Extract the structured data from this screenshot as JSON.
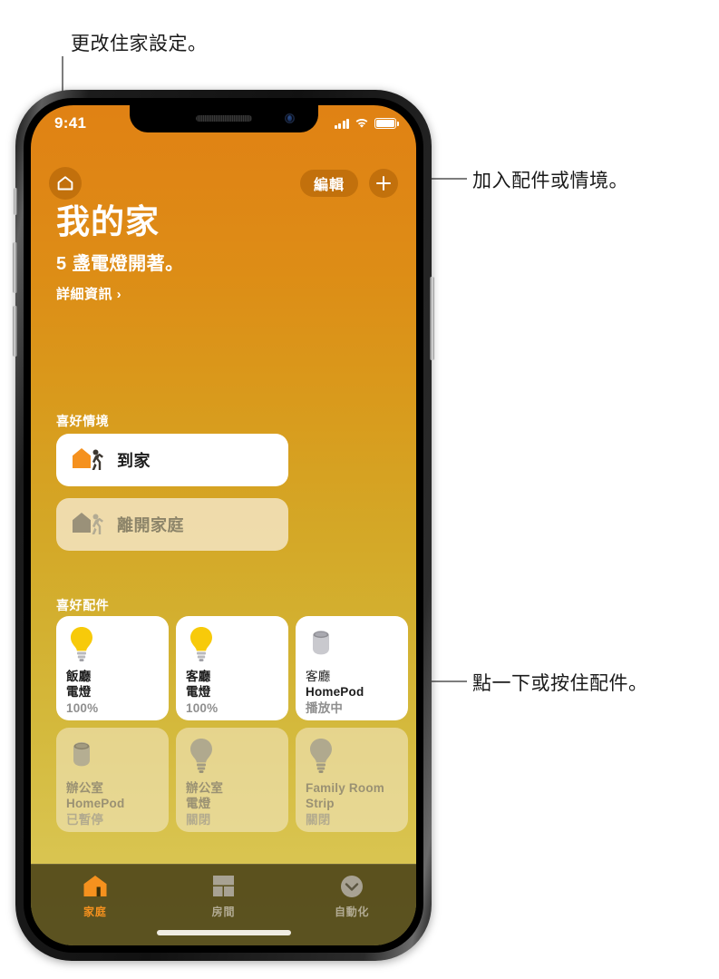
{
  "callouts": [
    {
      "id": "settings",
      "text": "更改住家設定。"
    },
    {
      "id": "add",
      "text": "加入配件或情境。"
    },
    {
      "id": "accessory",
      "text": "點一下或按住配件。"
    }
  ],
  "statusbar": {
    "time": "9:41",
    "cellular_icon": "signal-bars-icon",
    "wifi_icon": "wifi-icon",
    "battery_icon": "battery-icon"
  },
  "nav": {
    "home_icon": "house-icon",
    "edit_label": "編輯",
    "add_icon": "plus-icon"
  },
  "header": {
    "title": "我的家",
    "status": "5 盞電燈開著。",
    "details_link": "詳細資訊 ›"
  },
  "scenes": {
    "section_title": "喜好情境",
    "items": [
      {
        "label": "到家",
        "state": "on",
        "icon": "house-arriving-icon"
      },
      {
        "label": "離開家庭",
        "state": "off",
        "icon": "house-leaving-icon"
      }
    ]
  },
  "accessories": {
    "section_title": "喜好配件",
    "items": [
      {
        "name": "飯廳\n電燈",
        "name_line1": "飯廳",
        "name_line2": "電燈",
        "status": "100%",
        "state": "on",
        "icon": "lightbulb-icon",
        "name_weight": "bold"
      },
      {
        "name": "客廳\n電燈",
        "name_line1": "客廳",
        "name_line2": "電燈",
        "status": "100%",
        "state": "on",
        "icon": "lightbulb-icon",
        "name_weight": "bold"
      },
      {
        "name": "客廳\nHomePod",
        "name_line1": "客廳",
        "name_line2": "HomePod",
        "status": "播放中",
        "state": "on",
        "icon": "homepod-icon",
        "name_weight": "mixed"
      },
      {
        "name": "辦公室\nHomePod",
        "name_line1": "辦公室",
        "name_line2": "HomePod",
        "status": "已暫停",
        "state": "off",
        "icon": "homepod-icon",
        "name_weight": "bold"
      },
      {
        "name": "辦公室\n電燈",
        "name_line1": "辦公室",
        "name_line2": "電燈",
        "status": "關閉",
        "state": "off",
        "icon": "lightbulb-icon",
        "name_weight": "bold"
      },
      {
        "name": "Family Room\nStrip",
        "name_line1": "Family Room",
        "name_line2": "Strip",
        "status": "關閉",
        "state": "off",
        "icon": "lightbulb-icon",
        "name_weight": "bold"
      }
    ]
  },
  "tabbar": {
    "tabs": [
      {
        "label": "家庭",
        "icon": "house-filled-icon",
        "active": true
      },
      {
        "label": "房間",
        "icon": "rooms-icon",
        "active": false
      },
      {
        "label": "自動化",
        "icon": "automation-clock-icon",
        "active": false
      }
    ]
  },
  "colors": {
    "gradient_top": "#e08214",
    "gradient_bottom": "#dcca5c",
    "accent_orange": "#f5911e",
    "bulb_on": "#f7ca0a",
    "homepod_on": "#c9c9ce",
    "tile_off_text": "#9a9173"
  }
}
